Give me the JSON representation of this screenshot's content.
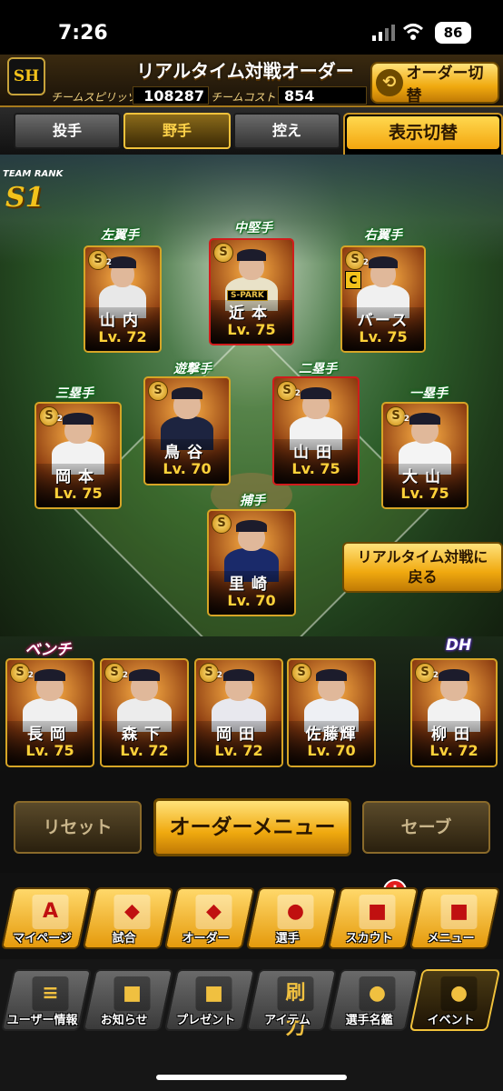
{
  "status_bar": {
    "time": "7:26",
    "battery": "86"
  },
  "header": {
    "logo": "SH",
    "title": "リアルタイム対戦オーダー",
    "team_spirits_label": "チームスピリッツ",
    "team_spirits_value": "108287",
    "team_cost_label": "チームコスト",
    "team_cost_value": "854",
    "order_switch_label": "オーダー切替"
  },
  "tabs": [
    {
      "label": "投手",
      "active": false
    },
    {
      "label": "野手",
      "active": true
    },
    {
      "label": "控え",
      "active": false
    }
  ],
  "display_switch": {
    "label": "表示切替",
    "value": "ー"
  },
  "team_rank": {
    "label": "TEAM RANK",
    "value": "S1"
  },
  "field_players": [
    {
      "position": "左翼手",
      "name": "山内",
      "level": "Lv. 72",
      "badge_num": "2",
      "body_color": "#e8e8e8"
    },
    {
      "position": "中堅手",
      "name": "近本",
      "level": "Lv. 75",
      "badge_num": "",
      "tag": "S-PARK",
      "body_color": "#e9e2c8"
    },
    {
      "position": "右翼手",
      "name": "バース",
      "level": "Lv. 75",
      "badge_num": "2",
      "extra_badge": "C",
      "body_color": "#f0f0f0"
    },
    {
      "position": "三塁手",
      "name": "岡本",
      "level": "Lv. 75",
      "badge_num": "2",
      "body_color": "#f2f2f2"
    },
    {
      "position": "遊撃手",
      "name": "鳥谷",
      "level": "Lv. 70",
      "badge_num": "",
      "body_color": "#1d2440"
    },
    {
      "position": "二塁手",
      "name": "山田",
      "level": "Lv. 75",
      "badge_num": "2",
      "body_color": "#f2f2f2"
    },
    {
      "position": "一塁手",
      "name": "大山",
      "level": "Lv. 75",
      "badge_num": "2",
      "body_color": "#f4f4f4"
    },
    {
      "position": "捕手",
      "name": "里崎",
      "level": "Lv. 70",
      "badge_num": "",
      "body_color": "#1a2a6a"
    }
  ],
  "return_button": {
    "line1": "リアルタイム対戦に",
    "line2": "戻る"
  },
  "bench": {
    "label": "ベンチ",
    "players": [
      {
        "name": "長岡",
        "level": "Lv. 75",
        "badge_num": "2",
        "body_color": "#f0f0f0"
      },
      {
        "name": "森下",
        "level": "Lv. 72",
        "badge_num": "2",
        "body_color": "#ececec"
      },
      {
        "name": "岡田",
        "level": "Lv. 72",
        "badge_num": "2",
        "body_color": "#e8e8ee"
      },
      {
        "name": "佐藤輝",
        "level": "Lv. 70",
        "badge_num": "",
        "body_color": "#eef0f4"
      }
    ]
  },
  "dh": {
    "label": "DH",
    "name": "柳田",
    "level": "Lv. 72",
    "badge_num": "2",
    "body_color": "#f2f2f2"
  },
  "actions": {
    "reset": "リセット",
    "order_menu": "オーダーメニュー",
    "save": "セーブ"
  },
  "nav_row1": [
    {
      "label": "マイページ",
      "icon": "A"
    },
    {
      "label": "試合",
      "icon": "◆"
    },
    {
      "label": "オーダー",
      "icon": "◆"
    },
    {
      "label": "選手",
      "icon": "●"
    },
    {
      "label": "スカウト",
      "icon": "■"
    },
    {
      "label": "メニュー",
      "icon": "■"
    }
  ],
  "nav_row2": [
    {
      "label": "ユーザー情報",
      "icon": "≡"
    },
    {
      "label": "お知らせ",
      "icon": "■"
    },
    {
      "label": "プレゼント",
      "icon": "■"
    },
    {
      "label": "アイテム",
      "icon": "刷力"
    },
    {
      "label": "選手名鑑",
      "icon": "●"
    },
    {
      "label": "イベント",
      "icon": "●"
    }
  ],
  "scout_alert": "!"
}
